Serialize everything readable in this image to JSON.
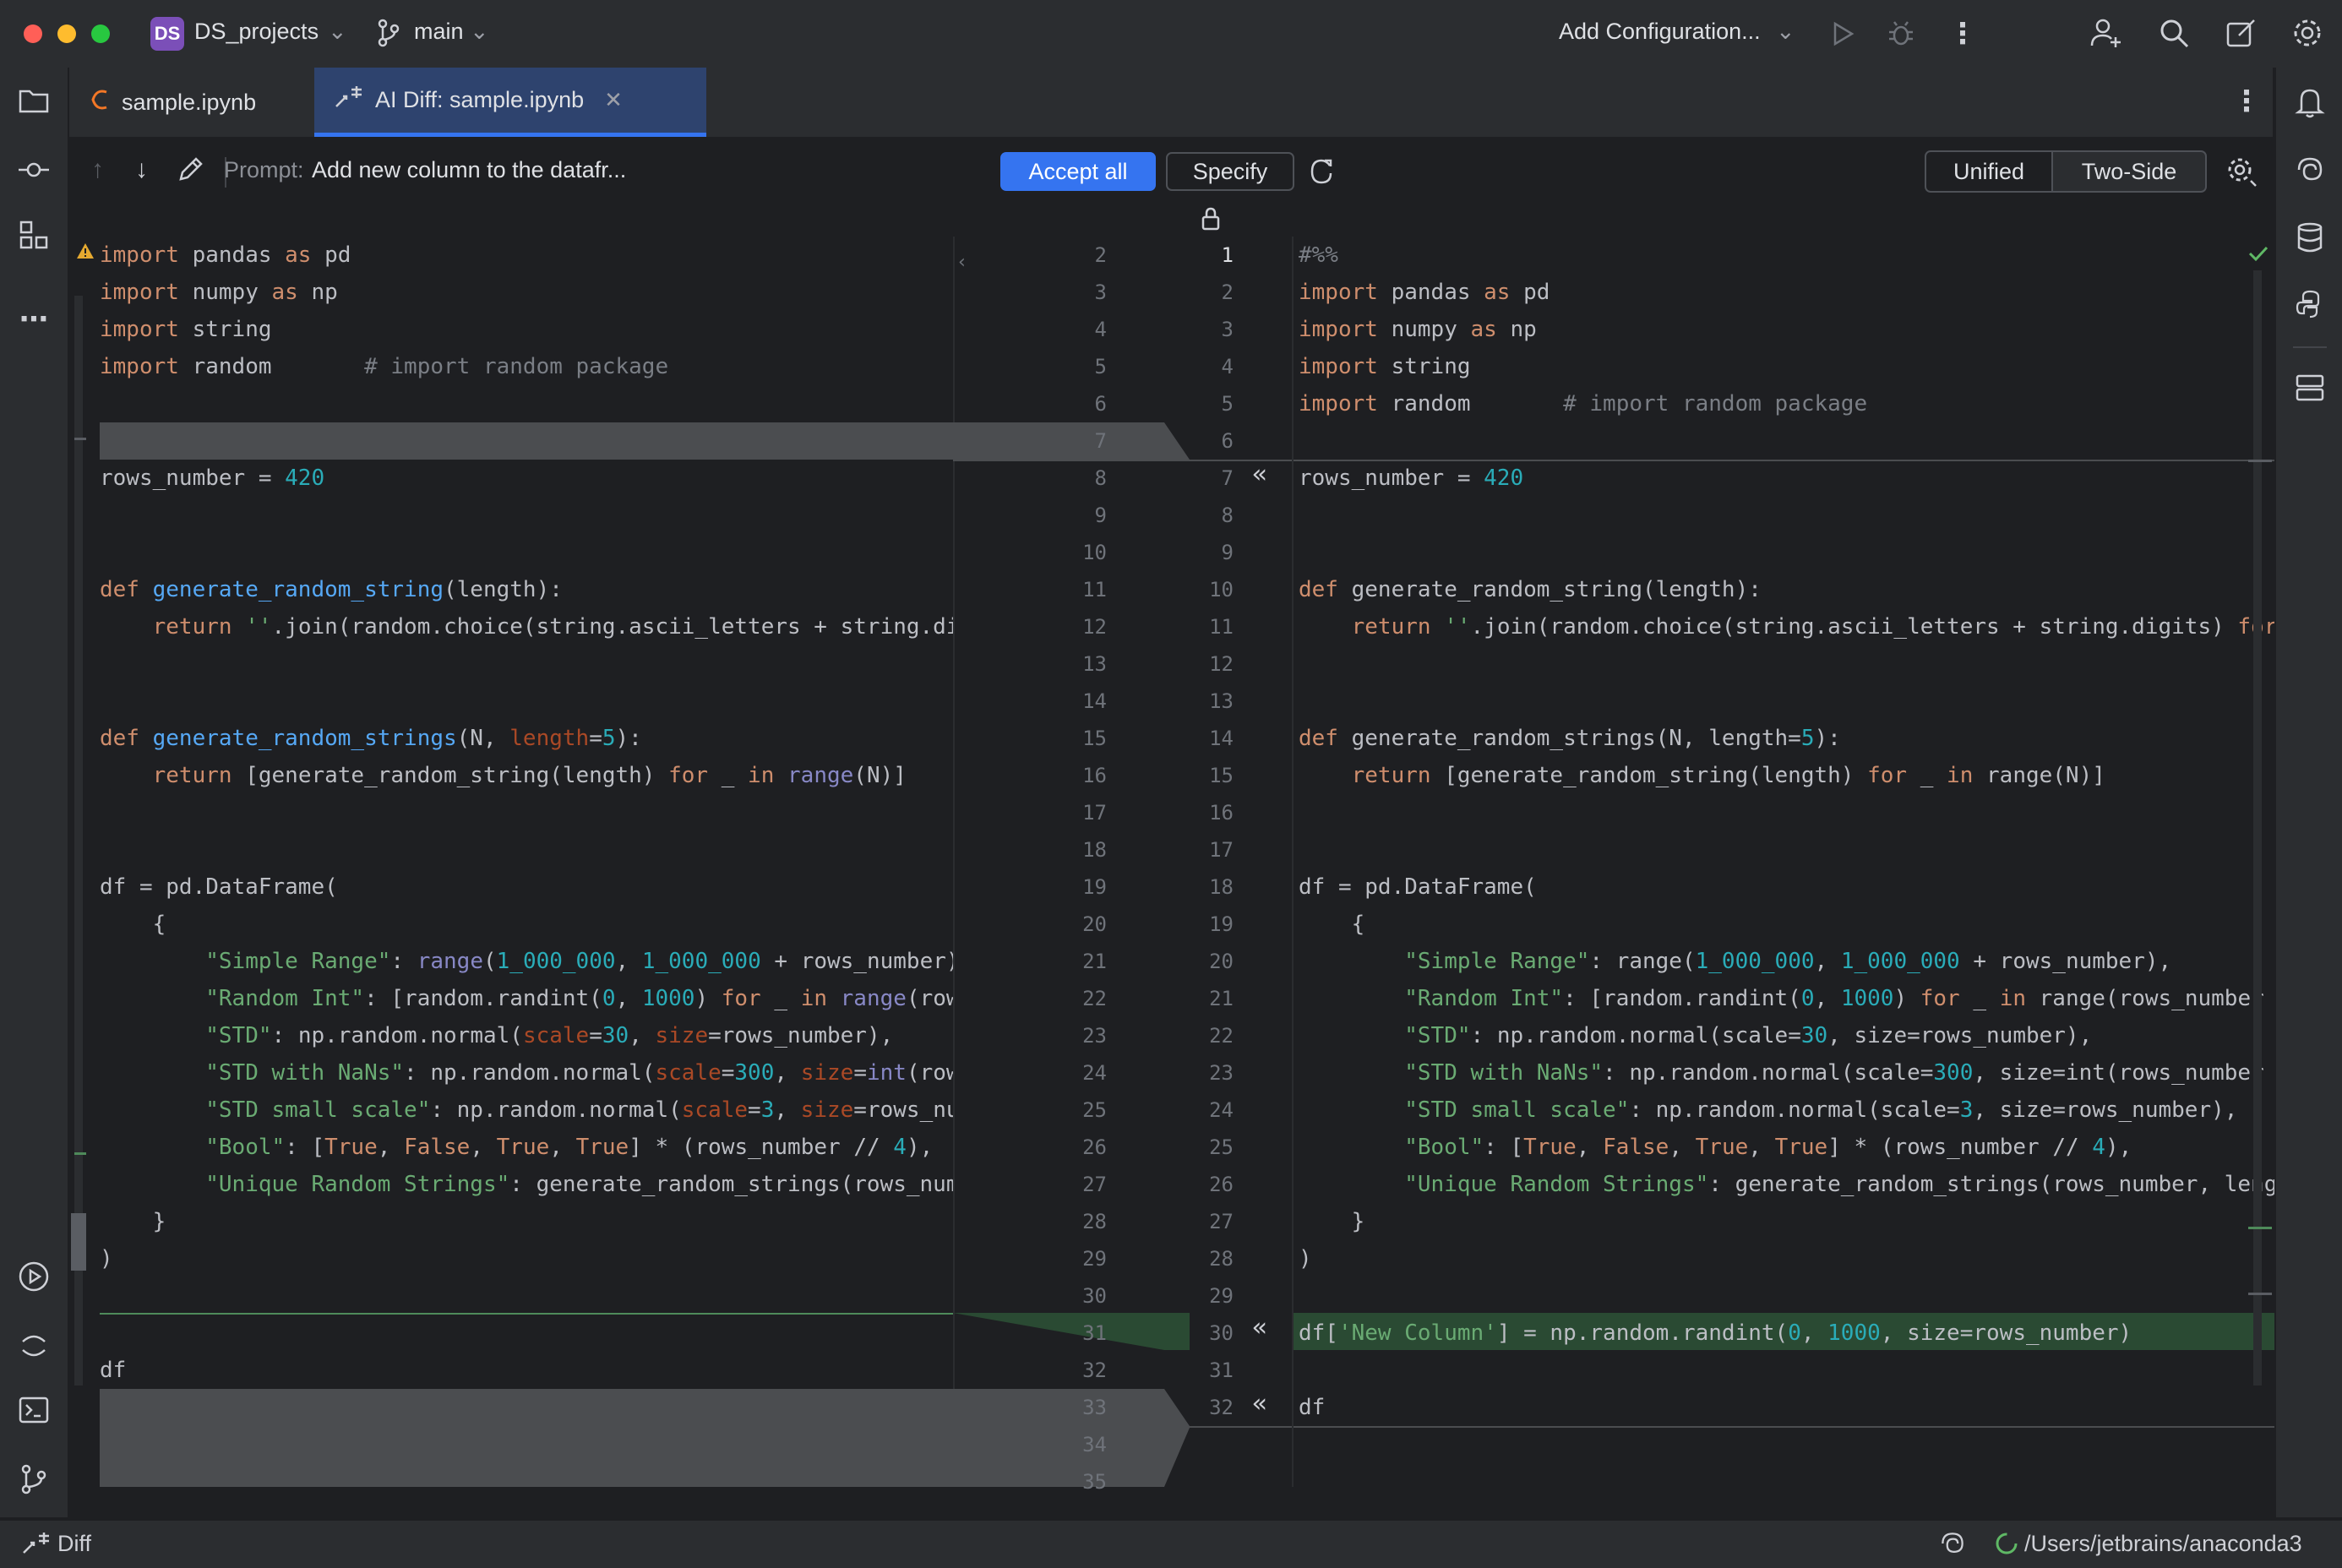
{
  "titlebar": {
    "project_badge": "DS",
    "project_name": "DS_projects",
    "branch": "main",
    "run_config": "Add Configuration...",
    "colors": {
      "close": "#ff5f57",
      "minimize": "#febc2e",
      "maximize": "#28c840",
      "badge": "#7b4fb8"
    }
  },
  "tabs": [
    {
      "label": "sample.ipynb",
      "icon": "jupyter-icon"
    },
    {
      "label": "AI Diff: sample.ipynb",
      "icon": "diff-icon",
      "active": true
    }
  ],
  "toolbar": {
    "prompt_label": "Prompt:",
    "prompt_text": "Add new column to the datafr...",
    "accept_all": "Accept all",
    "specify": "Specify",
    "view_unified": "Unified",
    "view_two_side": "Two-Side"
  },
  "left_lines": [
    {
      "num": "2",
      "code": "import pandas as pd"
    },
    {
      "num": "3",
      "code": "import numpy as np"
    },
    {
      "num": "4",
      "code": "import string"
    },
    {
      "num": "5",
      "code": "import random       # import random package"
    },
    {
      "num": "6",
      "code": ""
    },
    {
      "num": "7",
      "code": ""
    },
    {
      "num": "8",
      "code": "rows_number = 420"
    },
    {
      "num": "9",
      "code": ""
    },
    {
      "num": "10",
      "code": ""
    },
    {
      "num": "11",
      "code": "def generate_random_string(length):"
    },
    {
      "num": "12",
      "code": "    return ''.join(random.choice(string.ascii_letters + string.di"
    },
    {
      "num": "13",
      "code": ""
    },
    {
      "num": "14",
      "code": ""
    },
    {
      "num": "15",
      "code": "def generate_random_strings(N, length=5):"
    },
    {
      "num": "16",
      "code": "    return [generate_random_string(length) for _ in range(N)]"
    },
    {
      "num": "17",
      "code": ""
    },
    {
      "num": "18",
      "code": ""
    },
    {
      "num": "19",
      "code": "df = pd.DataFrame("
    },
    {
      "num": "20",
      "code": "    {"
    },
    {
      "num": "21",
      "code": "        \"Simple Range\": range(1_000_000, 1_000_000 + rows_number)"
    },
    {
      "num": "22",
      "code": "        \"Random Int\": [random.randint(0, 1000) for _ in range(row"
    },
    {
      "num": "23",
      "code": "        \"STD\": np.random.normal(scale=30, size=rows_number),"
    },
    {
      "num": "24",
      "code": "        \"STD with NaNs\": np.random.normal(scale=300, size=int(row"
    },
    {
      "num": "25",
      "code": "        \"STD small scale\": np.random.normal(scale=3, size=rows_nu"
    },
    {
      "num": "26",
      "code": "        \"Bool\": [True, False, True, True] * (rows_number // 4),"
    },
    {
      "num": "27",
      "code": "        \"Unique Random Strings\": generate_random_strings(rows_num"
    },
    {
      "num": "28",
      "code": "    }"
    },
    {
      "num": "29",
      "code": ")"
    },
    {
      "num": "30",
      "code": ""
    },
    {
      "num": "31",
      "code": ""
    },
    {
      "num": "32",
      "code": "df"
    },
    {
      "num": "33",
      "code": ""
    },
    {
      "num": "34",
      "code": ""
    },
    {
      "num": "35",
      "code": ""
    }
  ],
  "right_lines": [
    {
      "num": "1",
      "code": "#%%"
    },
    {
      "num": "2",
      "code": "import pandas as pd"
    },
    {
      "num": "3",
      "code": "import numpy as np"
    },
    {
      "num": "4",
      "code": "import string"
    },
    {
      "num": "5",
      "code": "import random       # import random package"
    },
    {
      "num": "6",
      "code": ""
    },
    {
      "num": "7",
      "code": "rows_number = 420"
    },
    {
      "num": "8",
      "code": ""
    },
    {
      "num": "9",
      "code": ""
    },
    {
      "num": "10",
      "code": "def generate_random_string(length):"
    },
    {
      "num": "11",
      "code": "    return ''.join(random.choice(string.ascii_letters + string.digits) for"
    },
    {
      "num": "12",
      "code": ""
    },
    {
      "num": "13",
      "code": ""
    },
    {
      "num": "14",
      "code": "def generate_random_strings(N, length=5):"
    },
    {
      "num": "15",
      "code": "    return [generate_random_string(length) for _ in range(N)]"
    },
    {
      "num": "16",
      "code": ""
    },
    {
      "num": "17",
      "code": ""
    },
    {
      "num": "18",
      "code": "df = pd.DataFrame("
    },
    {
      "num": "19",
      "code": "    {"
    },
    {
      "num": "20",
      "code": "        \"Simple Range\": range(1_000_000, 1_000_000 + rows_number),"
    },
    {
      "num": "21",
      "code": "        \"Random Int\": [random.randint(0, 1000) for _ in range(rows_number -"
    },
    {
      "num": "22",
      "code": "        \"STD\": np.random.normal(scale=30, size=rows_number),"
    },
    {
      "num": "23",
      "code": "        \"STD with NaNs\": np.random.normal(scale=300, size=int(rows_number *"
    },
    {
      "num": "24",
      "code": "        \"STD small scale\": np.random.normal(scale=3, size=rows_number),"
    },
    {
      "num": "25",
      "code": "        \"Bool\": [True, False, True, True] * (rows_number // 4),"
    },
    {
      "num": "26",
      "code": "        \"Unique Random Strings\": generate_random_strings(rows_number, lengt"
    },
    {
      "num": "27",
      "code": "    }"
    },
    {
      "num": "28",
      "code": ")"
    },
    {
      "num": "29",
      "code": ""
    },
    {
      "num": "30",
      "code": "df['New Column'] = np.random.randint(0, 1000, size=rows_number)"
    },
    {
      "num": "31",
      "code": ""
    },
    {
      "num": "32",
      "code": "df"
    }
  ],
  "statusbar": {
    "left": "Diff",
    "interpreter_path": "/Users/jetbrains/anaconda3"
  }
}
